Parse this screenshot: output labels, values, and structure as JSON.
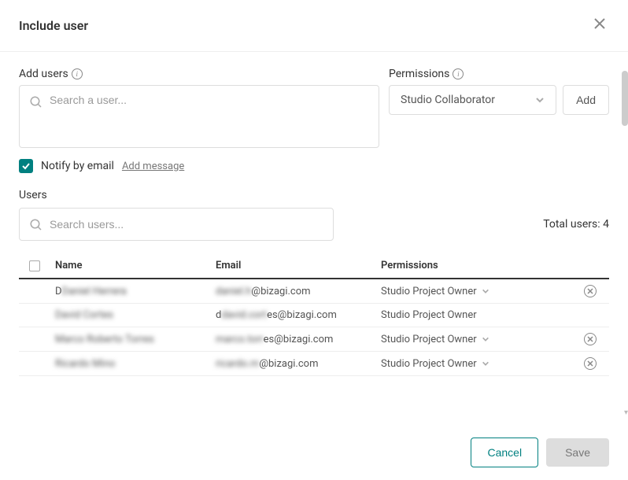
{
  "modal": {
    "title": "Include user"
  },
  "addUsers": {
    "label": "Add users",
    "placeholder": "Search a user..."
  },
  "permissions": {
    "label": "Permissions",
    "selected": "Studio Collaborator",
    "addButton": "Add"
  },
  "notify": {
    "label": "Notify by email",
    "checked": true,
    "addMessageLink": "Add message"
  },
  "usersSection": {
    "label": "Users",
    "searchPlaceholder": "Search users...",
    "totalLabel": "Total users: ",
    "totalCount": 4
  },
  "table": {
    "headers": {
      "name": "Name",
      "email": "Email",
      "permissions": "Permissions"
    },
    "rows": [
      {
        "nameRedacted": "Daniel Herrera",
        "emailPrefixRedacted": "daniel.h",
        "emailDomain": "@bizagi.com",
        "permission": "Studio Project Owner",
        "editable": true,
        "removable": true
      },
      {
        "nameRedacted": "David Cortes",
        "emailPrefixRedacted": "david.cort",
        "emailSuffix": "es@bizagi.com",
        "permission": "Studio Project Owner",
        "editable": false,
        "removable": false
      },
      {
        "nameRedacted": "Marco Roberto Torres",
        "emailPrefixRedacted": "marco.torr",
        "emailSuffix": "es@bizagi.com",
        "permission": "Studio Project Owner",
        "editable": true,
        "removable": true
      },
      {
        "nameRedacted": "Ricardo Mino",
        "emailPrefixRedacted": "ricardo.m",
        "emailDomainFull": "@bizagi.com",
        "permission": "Studio Project Owner",
        "editable": true,
        "removable": true
      }
    ]
  },
  "footer": {
    "cancel": "Cancel",
    "save": "Save"
  }
}
